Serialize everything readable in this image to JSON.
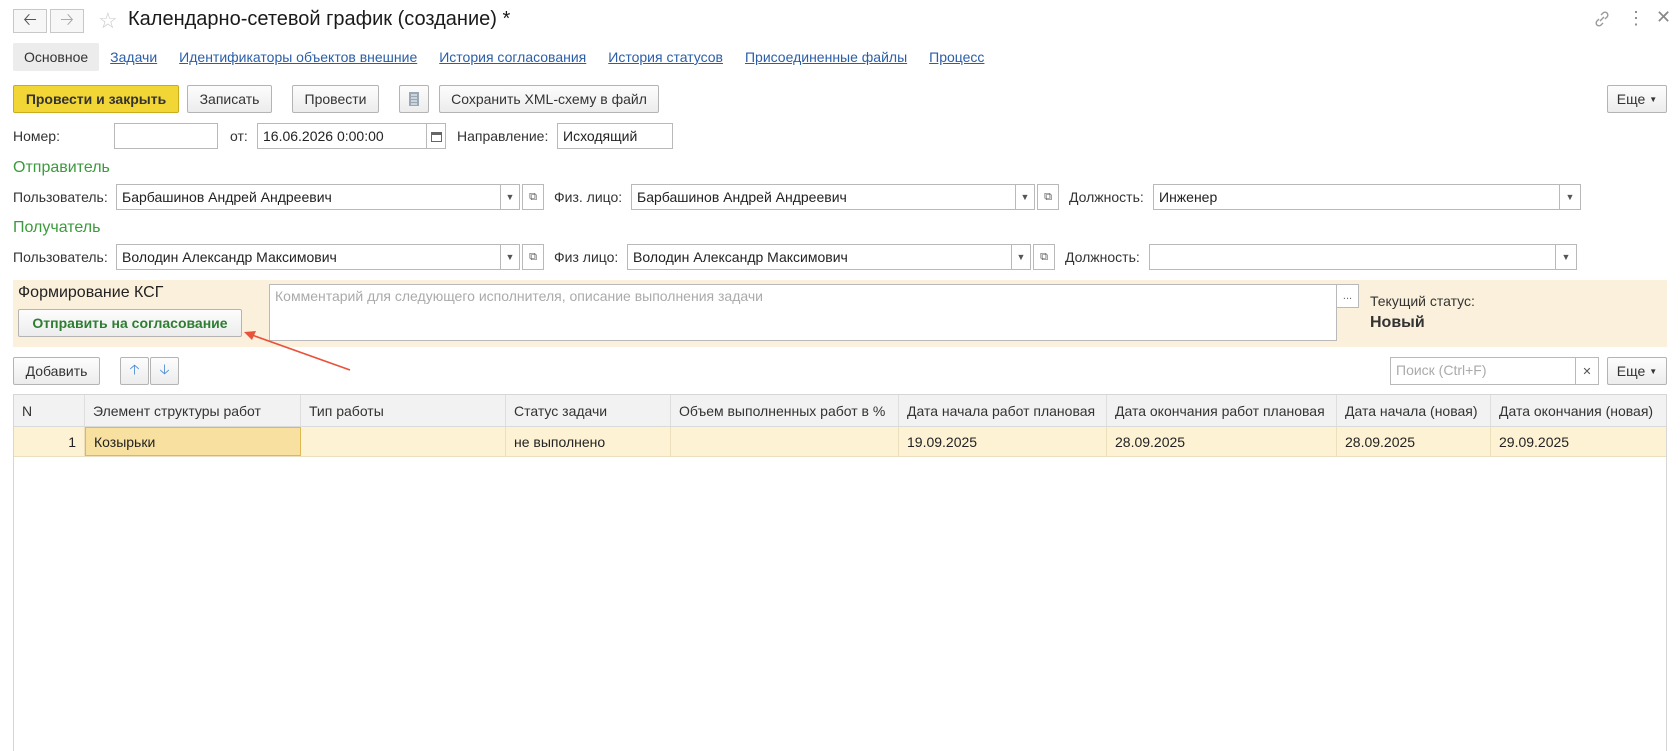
{
  "window": {
    "title": "Календарно-сетевой график (создание) *"
  },
  "tabs": [
    {
      "label": "Основное"
    },
    {
      "label": "Задачи"
    },
    {
      "label": "Идентификаторы объектов внешние"
    },
    {
      "label": "История согласования"
    },
    {
      "label": "История статусов"
    },
    {
      "label": "Присоединенные файлы"
    },
    {
      "label": "Процесс"
    }
  ],
  "toolbar": {
    "post_close_label": "Провести и закрыть",
    "save_label": "Записать",
    "post_label": "Провести",
    "save_xml_label": "Сохранить XML-схему в файл",
    "more_label": "Еще"
  },
  "header": {
    "number_label": "Номер:",
    "number_value": "",
    "date_label": "от:",
    "date_value": "16.06.2026  0:00:00",
    "direction_label": "Направление:",
    "direction_value": "Исходящий"
  },
  "sender": {
    "section_title": "Отправитель",
    "user_label": "Пользователь:",
    "user_value": "Барбашинов Андрей Андреевич",
    "person_label": "Физ. лицо:",
    "person_value": "Барбашинов Андрей Андреевич",
    "position_label": "Должность:",
    "position_value": "Инженер"
  },
  "recipient": {
    "section_title": "Получатель",
    "user_label": "Пользователь:",
    "user_value": "Володин Александр Максимович",
    "person_label": "Физ лицо:",
    "person_value": "Володин Александр Максимович",
    "position_label": "Должность:",
    "position_value": ""
  },
  "ksg": {
    "title": "Формирование КСГ",
    "send_button": "Отправить на согласование",
    "comment_placeholder": "Комментарий для следующего исполнителя, описание выполнения задачи",
    "status_label": "Текущий статус:",
    "status_value": "Новый"
  },
  "table_toolbar": {
    "add_label": "Добавить",
    "search_placeholder": "Поиск (Ctrl+F)",
    "more_label": "Еще"
  },
  "table": {
    "columns": [
      "N",
      "Элемент структуры работ",
      "Тип работы",
      "Статус задачи",
      "Объем выполненных работ в %",
      "Дата начала работ плановая",
      "Дата окончания работ плановая",
      "Дата начала (новая)",
      "Дата окончания (новая)"
    ],
    "rows": [
      [
        "1",
        "Козырьки",
        "",
        "не выполнено",
        "",
        "19.09.2025",
        "28.09.2025",
        "28.09.2025",
        "29.09.2025"
      ]
    ]
  },
  "colors": {
    "accent_yellow": "#f2d635",
    "section_green": "#3c9a3c",
    "link_blue": "#2b5ea8",
    "panel_bg": "#fbf0dc",
    "arrow_red": "#e8513a"
  },
  "icons": {
    "back": "arrow-left-icon",
    "forward": "arrow-right-icon",
    "favorite": "star-icon",
    "link": "link-icon",
    "menu": "kebab-menu-icon",
    "close": "close-icon"
  }
}
